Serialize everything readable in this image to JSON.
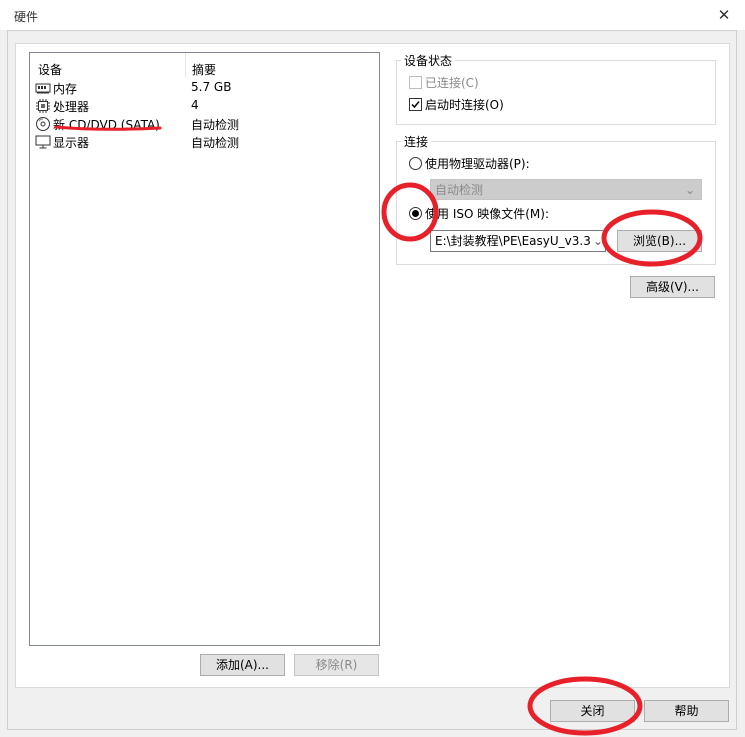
{
  "window": {
    "title": "硬件",
    "close_glyph": "✕"
  },
  "device_list": {
    "headers": {
      "device": "设备",
      "summary": "摘要"
    },
    "items": [
      {
        "name": "内存",
        "summary": "5.7 GB",
        "icon": "memory-icon"
      },
      {
        "name": "处理器",
        "summary": "4",
        "icon": "processor-icon"
      },
      {
        "name": "新 CD/DVD (SATA)",
        "summary": "自动检测",
        "icon": "cd-dvd-icon"
      },
      {
        "name": "显示器",
        "summary": "自动检测",
        "icon": "monitor-icon"
      }
    ]
  },
  "list_buttons": {
    "add_label": "添加(A)...",
    "remove_label": "移除(R)"
  },
  "device_status": {
    "title": "设备状态",
    "connected_label": "已连接(C)",
    "connected_checked": false,
    "connected_disabled": true,
    "connect_on_power_label": "启动时连接(O)",
    "connect_on_power_checked": true
  },
  "connection": {
    "title": "连接",
    "physical_drive_label": "使用物理驱动器(P):",
    "physical_drive_value": "自动检测",
    "iso_label": "使用 ISO 映像文件(M):",
    "iso_path": "E:\\封装教程\\PE\\EasyU_v3.3.",
    "browse_label": "浏览(B)...",
    "selected": "iso"
  },
  "advanced_label": "高级(V)...",
  "footer": {
    "close_label": "关闭",
    "help_label": "帮助"
  },
  "annotation_color": "#e8202a"
}
